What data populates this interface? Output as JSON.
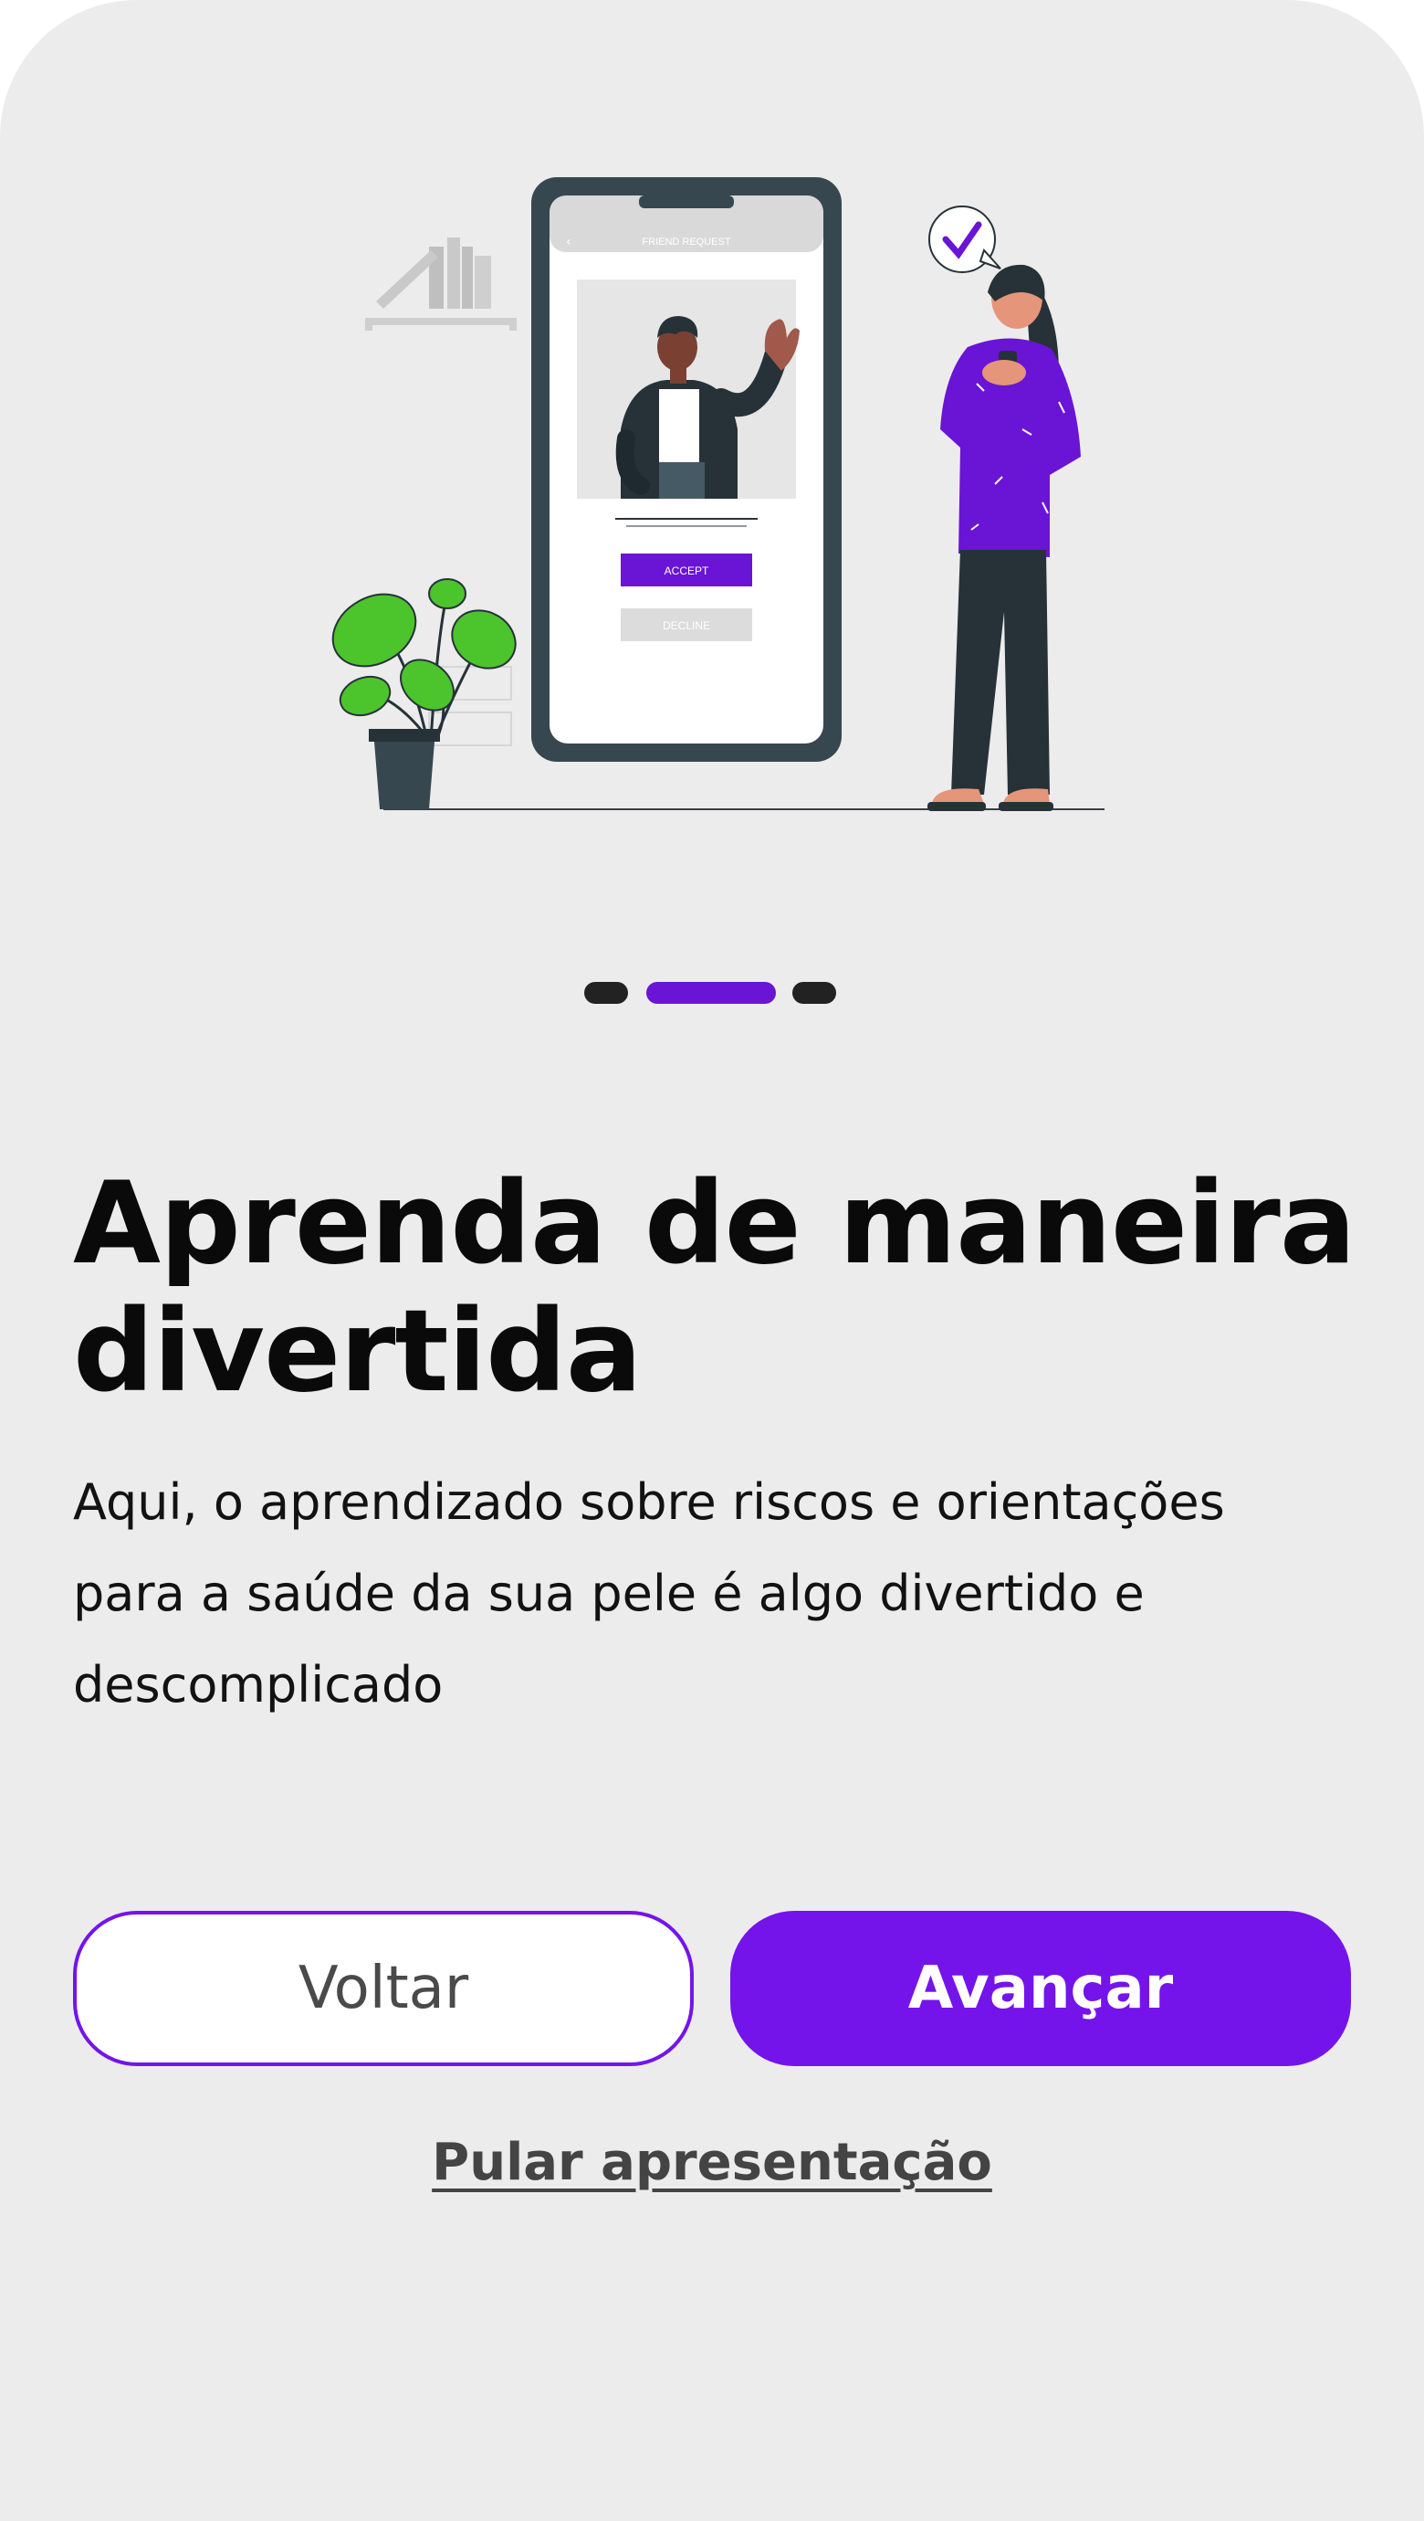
{
  "illustration": {
    "phone_header": "FRIEND REQUEST",
    "accept_label": "ACCEPT",
    "decline_label": "DECLINE"
  },
  "pager": {
    "total": 3,
    "active": 2
  },
  "content": {
    "title_line1": "Aprenda de maneira",
    "title_line2": "divertida",
    "body_line1": "Aqui, o aprendizado sobre riscos e orientações",
    "body_line2": "para a saúde da sua pele é algo divertido e",
    "body_line3": "descomplicado"
  },
  "actions": {
    "back_label": "Voltar",
    "next_label": "Avançar",
    "skip_label": "Pular apresentação"
  },
  "colors": {
    "accent": "#7414ea",
    "background": "#ececed",
    "plant": "#4cc42c",
    "skin": "#e5957a"
  }
}
